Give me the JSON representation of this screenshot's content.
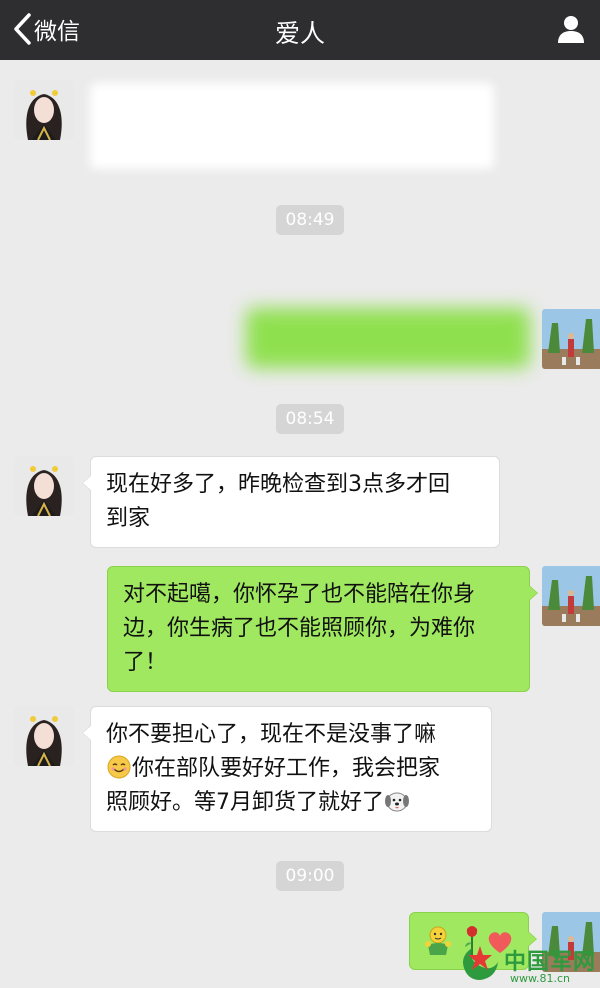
{
  "nav": {
    "back_label": "微信",
    "title": "爱人"
  },
  "timestamps": [
    "08:49",
    "08:54",
    "09:00"
  ],
  "messages": [
    {
      "side": "left",
      "text": "",
      "redacted": true
    },
    {
      "side": "right",
      "text": "",
      "redacted": true
    },
    {
      "side": "left",
      "line1": "现在好多了，昨晚检查到3点多才回",
      "line2": "到家"
    },
    {
      "side": "right",
      "line1": "对不起噶，你怀孕了也不能陪在你身",
      "line2": "边，你生病了也不能照顾你，为难你",
      "line3": "了！"
    },
    {
      "side": "left",
      "line1": "你不要担心了，现在不是没事了嘛",
      "line2": "你在部队要好好工作，我会把家",
      "line3": "照顾好。等7月卸货了就好了"
    },
    {
      "side": "right",
      "emojis": [
        "hug-face-icon",
        "rose-icon",
        "heart-icon"
      ]
    }
  ],
  "watermark": {
    "text": "中国军网",
    "url": "www.81.cn"
  },
  "colors": {
    "navbar": "#2e2e31",
    "background": "#ebebeb",
    "bubble_green": "#9fe860",
    "bubble_white": "#ffffff",
    "timestamp_bg": "#d5d5d5"
  }
}
